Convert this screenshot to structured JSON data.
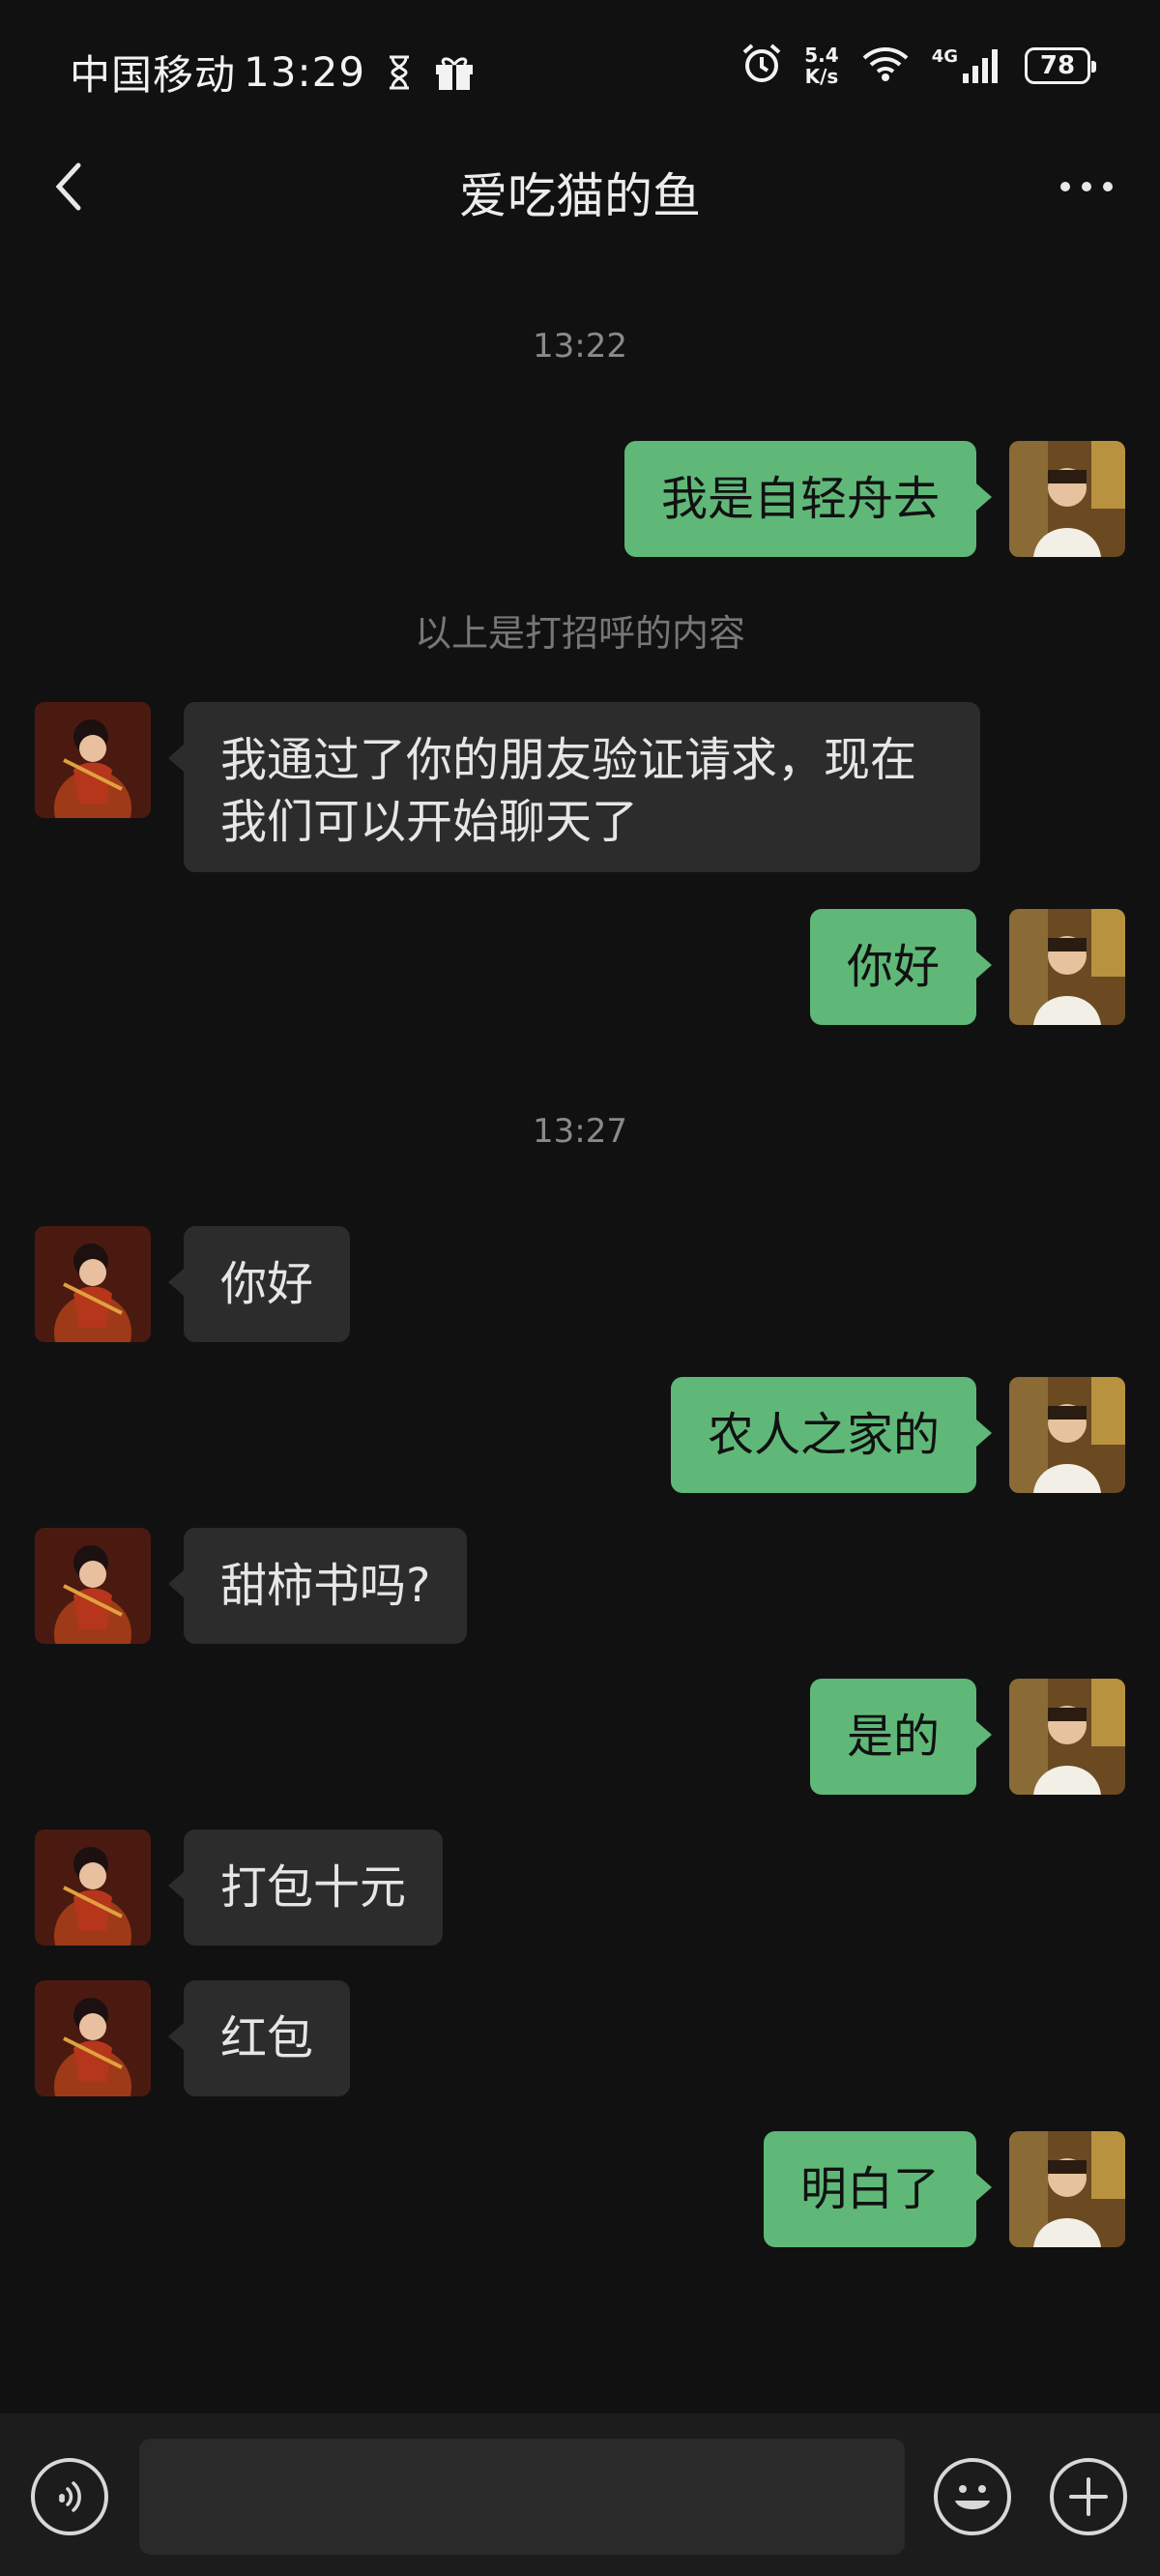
{
  "status_bar": {
    "carrier": "中国移动",
    "time": "13:29",
    "net_speed_value": "5.4",
    "net_speed_unit": "K/s",
    "network_type": "4G",
    "battery": "78"
  },
  "header": {
    "title": "爱吃猫的鱼"
  },
  "messages": [
    {
      "kind": "time",
      "text": "13:22"
    },
    {
      "kind": "msg",
      "from": "me",
      "text": "我是自轻舟去"
    },
    {
      "kind": "notice",
      "text": "以上是打招呼的内容"
    },
    {
      "kind": "msg",
      "from": "them",
      "text": "我通过了你的朋友验证请求，现在\n我们可以开始聊天了"
    },
    {
      "kind": "msg",
      "from": "me",
      "text": "你好"
    },
    {
      "kind": "time",
      "text": "13:27"
    },
    {
      "kind": "msg",
      "from": "them",
      "text": "你好"
    },
    {
      "kind": "msg",
      "from": "me",
      "text": "农人之家的"
    },
    {
      "kind": "msg",
      "from": "them",
      "text": "甜柿书吗?"
    },
    {
      "kind": "msg",
      "from": "me",
      "text": "是的"
    },
    {
      "kind": "msg",
      "from": "them",
      "text": "打包十元"
    },
    {
      "kind": "msg",
      "from": "them",
      "text": "红包"
    },
    {
      "kind": "msg",
      "from": "me",
      "text": "明白了"
    }
  ],
  "input_bar": {
    "value": "",
    "voice_icon": "voice-icon",
    "emoji_icon": "emoji-icon",
    "plus_icon": "plus-icon"
  },
  "colors": {
    "background": "#111111",
    "my_bubble": "#5fb878",
    "their_bubble": "#2c2c2c"
  }
}
